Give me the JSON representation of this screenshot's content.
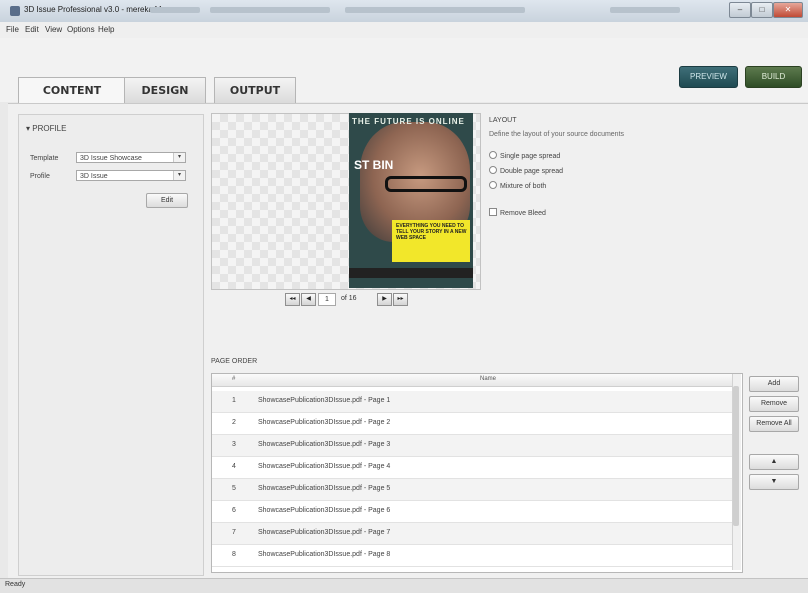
{
  "window": {
    "title": "3D Issue Professional v3.0 - mereka44",
    "controls": {
      "minimize": "–",
      "maximize": "□",
      "close": "✕"
    }
  },
  "menu": [
    "File",
    "Edit",
    "View",
    "Options",
    "Help"
  ],
  "tabs": [
    {
      "label": "CONTENT",
      "active": true
    },
    {
      "label": "DESIGN",
      "active": false
    },
    {
      "label": "OUTPUT",
      "active": false
    }
  ],
  "actions": {
    "preview": "PREVIEW",
    "build": "BUILD"
  },
  "profile": {
    "section_title": "▾ PROFILE",
    "template_label": "Template",
    "template_value": "3D Issue Showcase",
    "profile_label": "Profile",
    "profile_value": "3D Issue",
    "edit_button": "Edit"
  },
  "preview": {
    "magazine_title": "THE FUTURE IS ONLINE",
    "magazine_headline": "ST BIN",
    "magazine_callout": "EVERYTHING YOU NEED TO TELL YOUR STORY IN A NEW WEB SPACE",
    "current_page": "1",
    "page_total_text": "of 16",
    "nav": {
      "first": "◂◂",
      "prev": "◀",
      "next": "▶",
      "last": "▸▸"
    }
  },
  "layout": {
    "title": "LAYOUT",
    "description": "Define the layout of your source documents",
    "options": [
      {
        "label": "Single page spread",
        "selected": false
      },
      {
        "label": "Double page spread",
        "selected": false
      },
      {
        "label": "Mixture of both",
        "selected": false
      }
    ],
    "remove_bleed_label": "Remove Bleed"
  },
  "page_order": {
    "title": "PAGE ORDER",
    "columns": {
      "number": "#",
      "name": "Name"
    },
    "rows": [
      {
        "num": "1",
        "name": "ShowcasePublication3DIssue.pdf - Page 1"
      },
      {
        "num": "2",
        "name": "ShowcasePublication3DIssue.pdf - Page 2"
      },
      {
        "num": "3",
        "name": "ShowcasePublication3DIssue.pdf - Page 3"
      },
      {
        "num": "4",
        "name": "ShowcasePublication3DIssue.pdf - Page 4"
      },
      {
        "num": "5",
        "name": "ShowcasePublication3DIssue.pdf - Page 5"
      },
      {
        "num": "6",
        "name": "ShowcasePublication3DIssue.pdf - Page 6"
      },
      {
        "num": "7",
        "name": "ShowcasePublication3DIssue.pdf - Page 7"
      },
      {
        "num": "8",
        "name": "ShowcasePublication3DIssue.pdf - Page 8"
      }
    ],
    "buttons": {
      "add": "Add",
      "remove": "Remove",
      "remove_all": "Remove All",
      "up": "▲",
      "down": "▼"
    }
  },
  "status": "Ready",
  "colors": {
    "preview_button": "#2b5a62",
    "build_button": "#3f5f34",
    "callout": "#f2e72a"
  }
}
